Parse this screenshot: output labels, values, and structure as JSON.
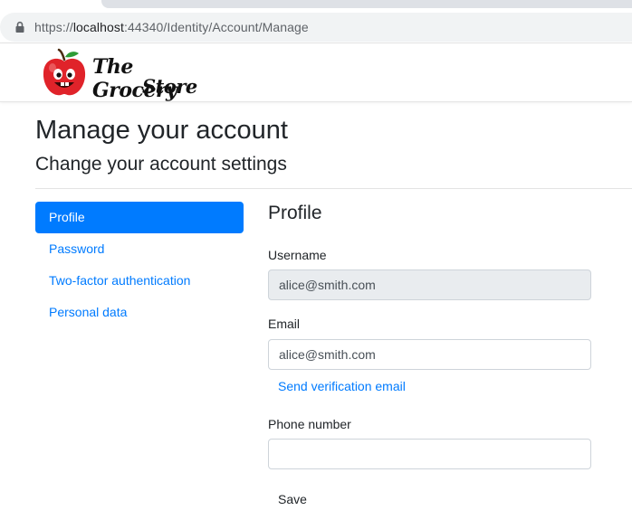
{
  "browser": {
    "url_protocol": "https://",
    "url_host": "localhost",
    "url_rest": ":44340/Identity/Account/Manage"
  },
  "brand": {
    "line1": "The Grocery",
    "line2": "Store",
    "logo_icon": "apple-mascot-icon",
    "logo_color": "#e0232a"
  },
  "page": {
    "title": "Manage your account",
    "subtitle": "Change your account settings"
  },
  "sidebar": {
    "items": [
      {
        "label": "Profile",
        "active": true
      },
      {
        "label": "Password",
        "active": false
      },
      {
        "label": "Two-factor authentication",
        "active": false
      },
      {
        "label": "Personal data",
        "active": false
      }
    ]
  },
  "profile_form": {
    "heading": "Profile",
    "username_label": "Username",
    "username_value": "alice@smith.com",
    "email_label": "Email",
    "email_value": "alice@smith.com",
    "send_verification_label": "Send verification email",
    "phone_label": "Phone number",
    "phone_value": "",
    "save_label": "Save"
  },
  "colors": {
    "primary": "#007bff",
    "disabled_input": "#e9ecef"
  }
}
